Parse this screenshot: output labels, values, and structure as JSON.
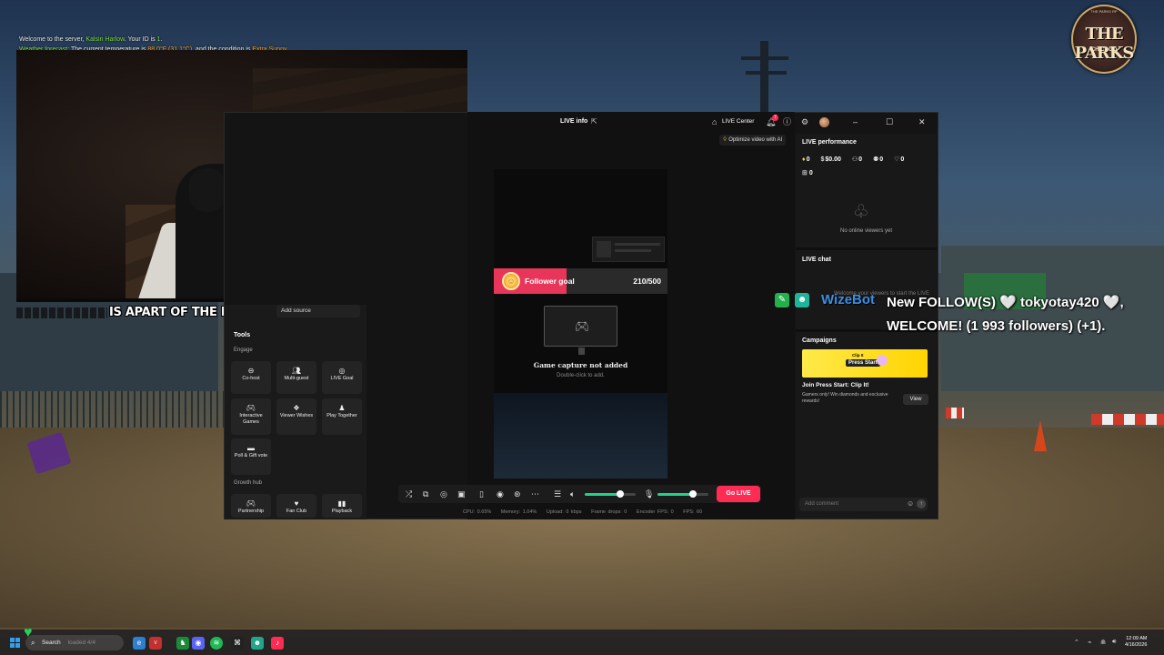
{
  "server_chat": {
    "line1_prefix": "Welcome to the server, ",
    "line1_name": "Kalsin Harlow",
    "line1_mid": ". Your ID is ",
    "line1_id": "1",
    "line1_end": ".",
    "line2_prefix": "Weather forecast: ",
    "line2_mid": "The current temperature is ",
    "line2_temp": "88.0°F (31.1°C)",
    "line2_cond_prefix": ", and the condition is ",
    "line2_cond": "Extra Sunny"
  },
  "webcam_overlay": {
    "family_text": "IS APART OF THE FAMILY !"
  },
  "logo": {
    "main": "THE PARKS",
    "sub": "CHICAGO",
    "top": "THE PARKS RP"
  },
  "studio": {
    "title": "LIVE info",
    "live_center": "LIVE Center",
    "notification_count": "7",
    "optimize_label": "Optimize video with AI",
    "follower_goal": {
      "label": "Follower goal",
      "current": 210,
      "target": 500,
      "value_text": "210/500"
    },
    "capture": {
      "title": "Game capture not added",
      "subtitle": "Double-click to add."
    },
    "go_live": "Go LIVE",
    "stats": {
      "cpu": "CPU: 0.65%",
      "memory": "Memory: 1.04%",
      "upload": "Upload: 0 kbps",
      "frame_drops": "Frame drops: 0",
      "encoder_fps": "Encoder FPS: 0",
      "fps": "FPS: 60"
    },
    "sliders": {
      "speaker_level": 0.7,
      "mic_level": 0.7
    },
    "left_panel": {
      "add_source": "Add source",
      "tools_title": "Tools",
      "engage_title": "Engage",
      "growth_title": "Growth hub",
      "tools": [
        {
          "label": "Co-host",
          "icon": "cohost-icon"
        },
        {
          "label": "Multi-guest",
          "icon": "multiguest-icon"
        },
        {
          "label": "LIVE Goal",
          "icon": "goal-icon"
        },
        {
          "label": "Interactive Games",
          "icon": "gamepad-icon"
        },
        {
          "label": "Viewer Wishes",
          "icon": "gift-icon"
        },
        {
          "label": "Play Together",
          "icon": "play-together-icon"
        },
        {
          "label": "Poll & Gift vote",
          "icon": "poll-icon"
        }
      ],
      "growth": [
        {
          "label": "Partnership",
          "icon": "gamepad-icon"
        },
        {
          "label": "Fan Club",
          "icon": "heart-icon"
        },
        {
          "label": "Playback",
          "icon": "playback-icon"
        }
      ]
    },
    "right_panel": {
      "performance_title": "LIVE performance",
      "stats": [
        {
          "icon": "diamond-icon",
          "value": "0"
        },
        {
          "icon": "dollar-icon",
          "value": "$0.00"
        },
        {
          "icon": "viewers-icon",
          "value": "0"
        },
        {
          "icon": "new-followers-icon",
          "value": "0"
        },
        {
          "icon": "likes-icon",
          "value": "0"
        }
      ],
      "gifts_value": "0",
      "no_viewers": "No online viewers yet",
      "chat_title": "LIVE chat",
      "chat_faint": "Welcome your viewers to start the LIVE",
      "campaigns_title": "Campaigns",
      "campaign": {
        "banner_clip": "Clip It",
        "banner_title": "Press Start",
        "title": "Join Press Start: Clip It!",
        "description": "Gamers only! Win diamonds and exclusive rewards!",
        "button": "View"
      },
      "comment_placeholder": "Add comment"
    }
  },
  "follow_alert": {
    "bot_name": "WizeBot",
    "message": "New FOLLOW(S) 🤍 tokyotay420 🤍, WELCOME! (1 993 followers) (+1)."
  },
  "taskbar": {
    "search_label": "Search",
    "search_faint": "loaded 4/4",
    "time": "12:09 AM",
    "date": "4/16/2026"
  }
}
